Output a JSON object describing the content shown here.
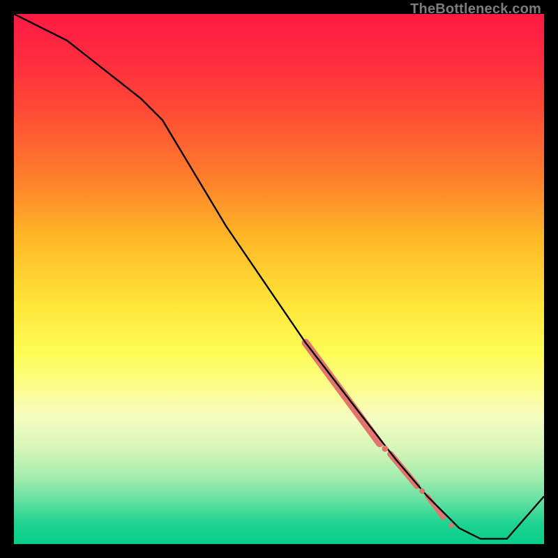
{
  "watermark": "TheBottleneck.com",
  "chart_data": {
    "type": "line",
    "title": "",
    "xlabel": "",
    "ylabel": "",
    "xlim": [
      0,
      100
    ],
    "ylim": [
      0,
      100
    ],
    "grid": false,
    "series": [
      {
        "name": "curve",
        "x": [
          0,
          10,
          24,
          28,
          40,
          55,
          65,
          72,
          78,
          84,
          88,
          93,
          100
        ],
        "y": [
          100,
          95,
          84,
          80,
          60,
          38,
          25,
          16,
          9,
          3,
          1,
          1,
          9
        ]
      }
    ],
    "highlight_segments": [
      {
        "x0": 55,
        "y0": 38,
        "x1": 69,
        "y1": 19,
        "width": 11
      },
      {
        "x0": 71,
        "y0": 17,
        "x1": 76,
        "y1": 11,
        "width": 9
      },
      {
        "x0": 78,
        "y0": 9,
        "x1": 81,
        "y1": 5,
        "width": 7
      }
    ],
    "highlight_dots": [
      {
        "x": 70.0,
        "y": 18.0,
        "r": 4.5
      },
      {
        "x": 77.0,
        "y": 10.0,
        "r": 4.0
      },
      {
        "x": 82.5,
        "y": 3.5,
        "r": 3.5
      }
    ],
    "colors": {
      "curve": "#000000",
      "highlight": "#e2766f"
    }
  }
}
